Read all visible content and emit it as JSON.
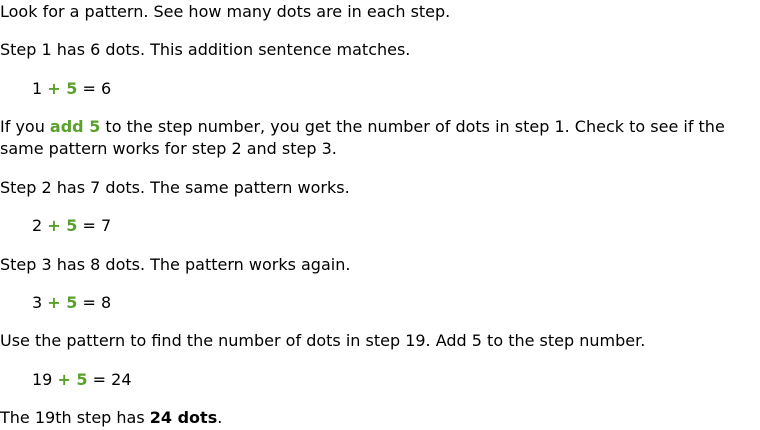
{
  "intro": "Look for a pattern. See how many dots are in each step.",
  "step1_text": "Step 1 has 6 dots. This addition sentence matches.",
  "eq1": {
    "a": "1",
    "op": "+ 5",
    "eq": "= 6"
  },
  "explain": {
    "before": "If you ",
    "highlight": "add 5",
    "after": " to the step number, you get the number of dots in step 1. Check to see if the same pattern works for step 2 and step 3."
  },
  "step2_text": "Step 2 has 7 dots. The same pattern works.",
  "eq2": {
    "a": "2",
    "op": "+ 5",
    "eq": "= 7"
  },
  "step3_text": "Step 3 has 8 dots. The pattern works again.",
  "eq3": {
    "a": "3",
    "op": "+ 5",
    "eq": "= 8"
  },
  "step19_text": "Use the pattern to find the number of dots in step 19. Add 5 to the step number.",
  "eq4": {
    "a": "19",
    "op": "+ 5",
    "eq": "= 24"
  },
  "conclusion": {
    "before": "The 19th step has ",
    "bold": "24 dots",
    "after": "."
  },
  "colors": {
    "accent_green": "#5aa02c",
    "text": "#000000",
    "background": "#ffffff"
  }
}
